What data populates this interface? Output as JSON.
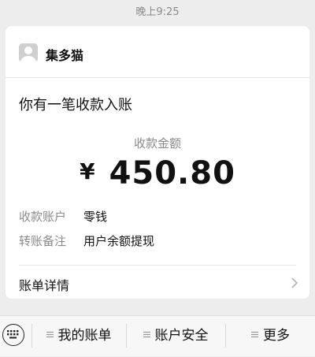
{
  "timestamp": "晚上9:25",
  "card": {
    "sender_name": "集多猫",
    "notice_title": "你有一笔收款入账",
    "amount_label": "收款金额",
    "currency_symbol": "¥",
    "amount": "450.80",
    "details": [
      {
        "key": "收款账户",
        "value": "零钱"
      },
      {
        "key": "转账备注",
        "value": "用户余额提现"
      }
    ],
    "bill_details_label": "账单详情"
  },
  "bottom_menu": {
    "items": [
      {
        "label": "我的账单"
      },
      {
        "label": "账户安全"
      },
      {
        "label": "更多"
      }
    ]
  }
}
